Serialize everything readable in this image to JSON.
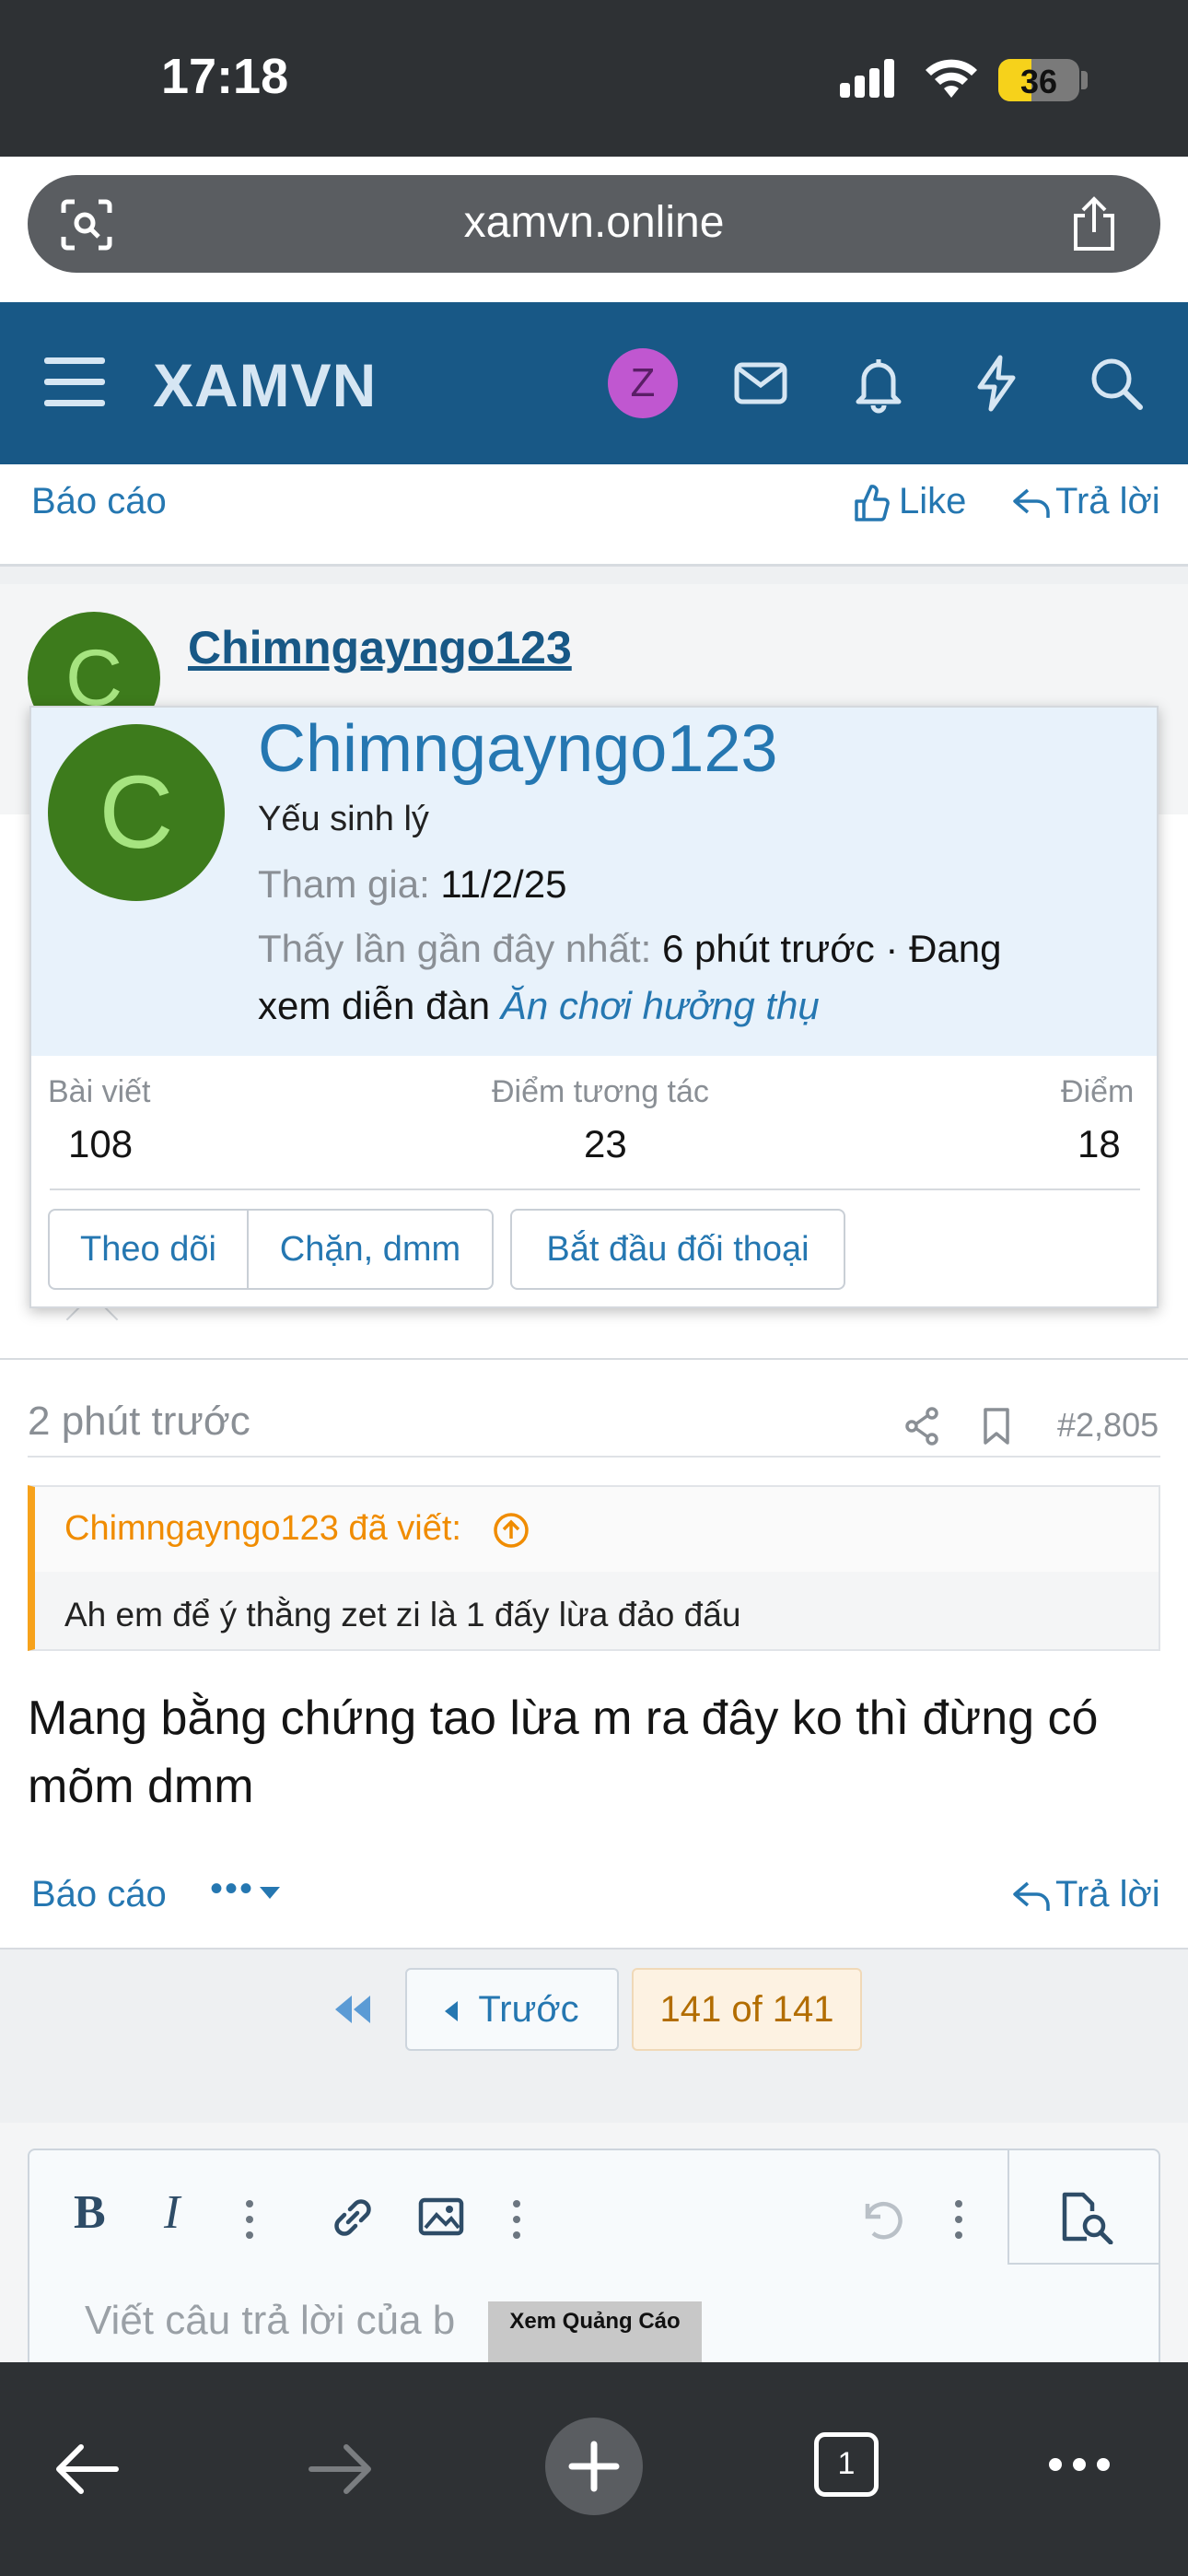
{
  "status_bar": {
    "time": "17:18",
    "battery": "36"
  },
  "browser": {
    "url": "xamvn.online"
  },
  "site_header": {
    "brand": "XAMVN",
    "avatar_letter": "Z"
  },
  "prev_post_actions": {
    "report": "Báo cáo",
    "like": "Like",
    "reply": "Trả lời"
  },
  "post_author": {
    "username": "Chimngayngo123",
    "avatar_letter": "C"
  },
  "member_card": {
    "username": "Chimngayngo123",
    "user_title": "Yếu sinh lý",
    "joined_label": "Tham gia:",
    "joined_value": "11/2/25",
    "last_seen_label": "Thấy lần gần đây nhất:",
    "last_seen_value": "6 phút trước · Đang",
    "activity_prefix": "xem diễn đàn",
    "activity_forum": "Ăn chơi hưởng thụ",
    "stats": [
      {
        "label": "Bài viết",
        "value": "108"
      },
      {
        "label": "Điểm tương tác",
        "value": "23"
      },
      {
        "label": "Điểm",
        "value": "18"
      }
    ],
    "buttons": {
      "follow": "Theo dõi",
      "block": "Chặn, dmm",
      "conversation": "Bắt đầu đối thoại"
    }
  },
  "post": {
    "time": "2 phút trước",
    "number": "#2,805",
    "quote_author": "Chimngayngo123 đã viết:",
    "quote_text": "Ah em để ý thằng zet zi là 1 đấy lừa đảo đấu",
    "body": "Mang bằng chứng tao lừa m ra đây ko thì đừng có mõm dmm",
    "report": "Báo cáo",
    "more": "•••",
    "reply": "Trả lời"
  },
  "pagination": {
    "prev": "Trước",
    "current": "141 of 141"
  },
  "editor": {
    "placeholder": "Viết câu trả lời của b",
    "ad_label": "Xem Quảng Cáo"
  },
  "bottom_bar": {
    "tab_count": "1"
  },
  "colors": {
    "header": "#185886",
    "link": "#2577b1",
    "quote_accent": "#f7a21b",
    "avatar": "#3d7b1c"
  }
}
